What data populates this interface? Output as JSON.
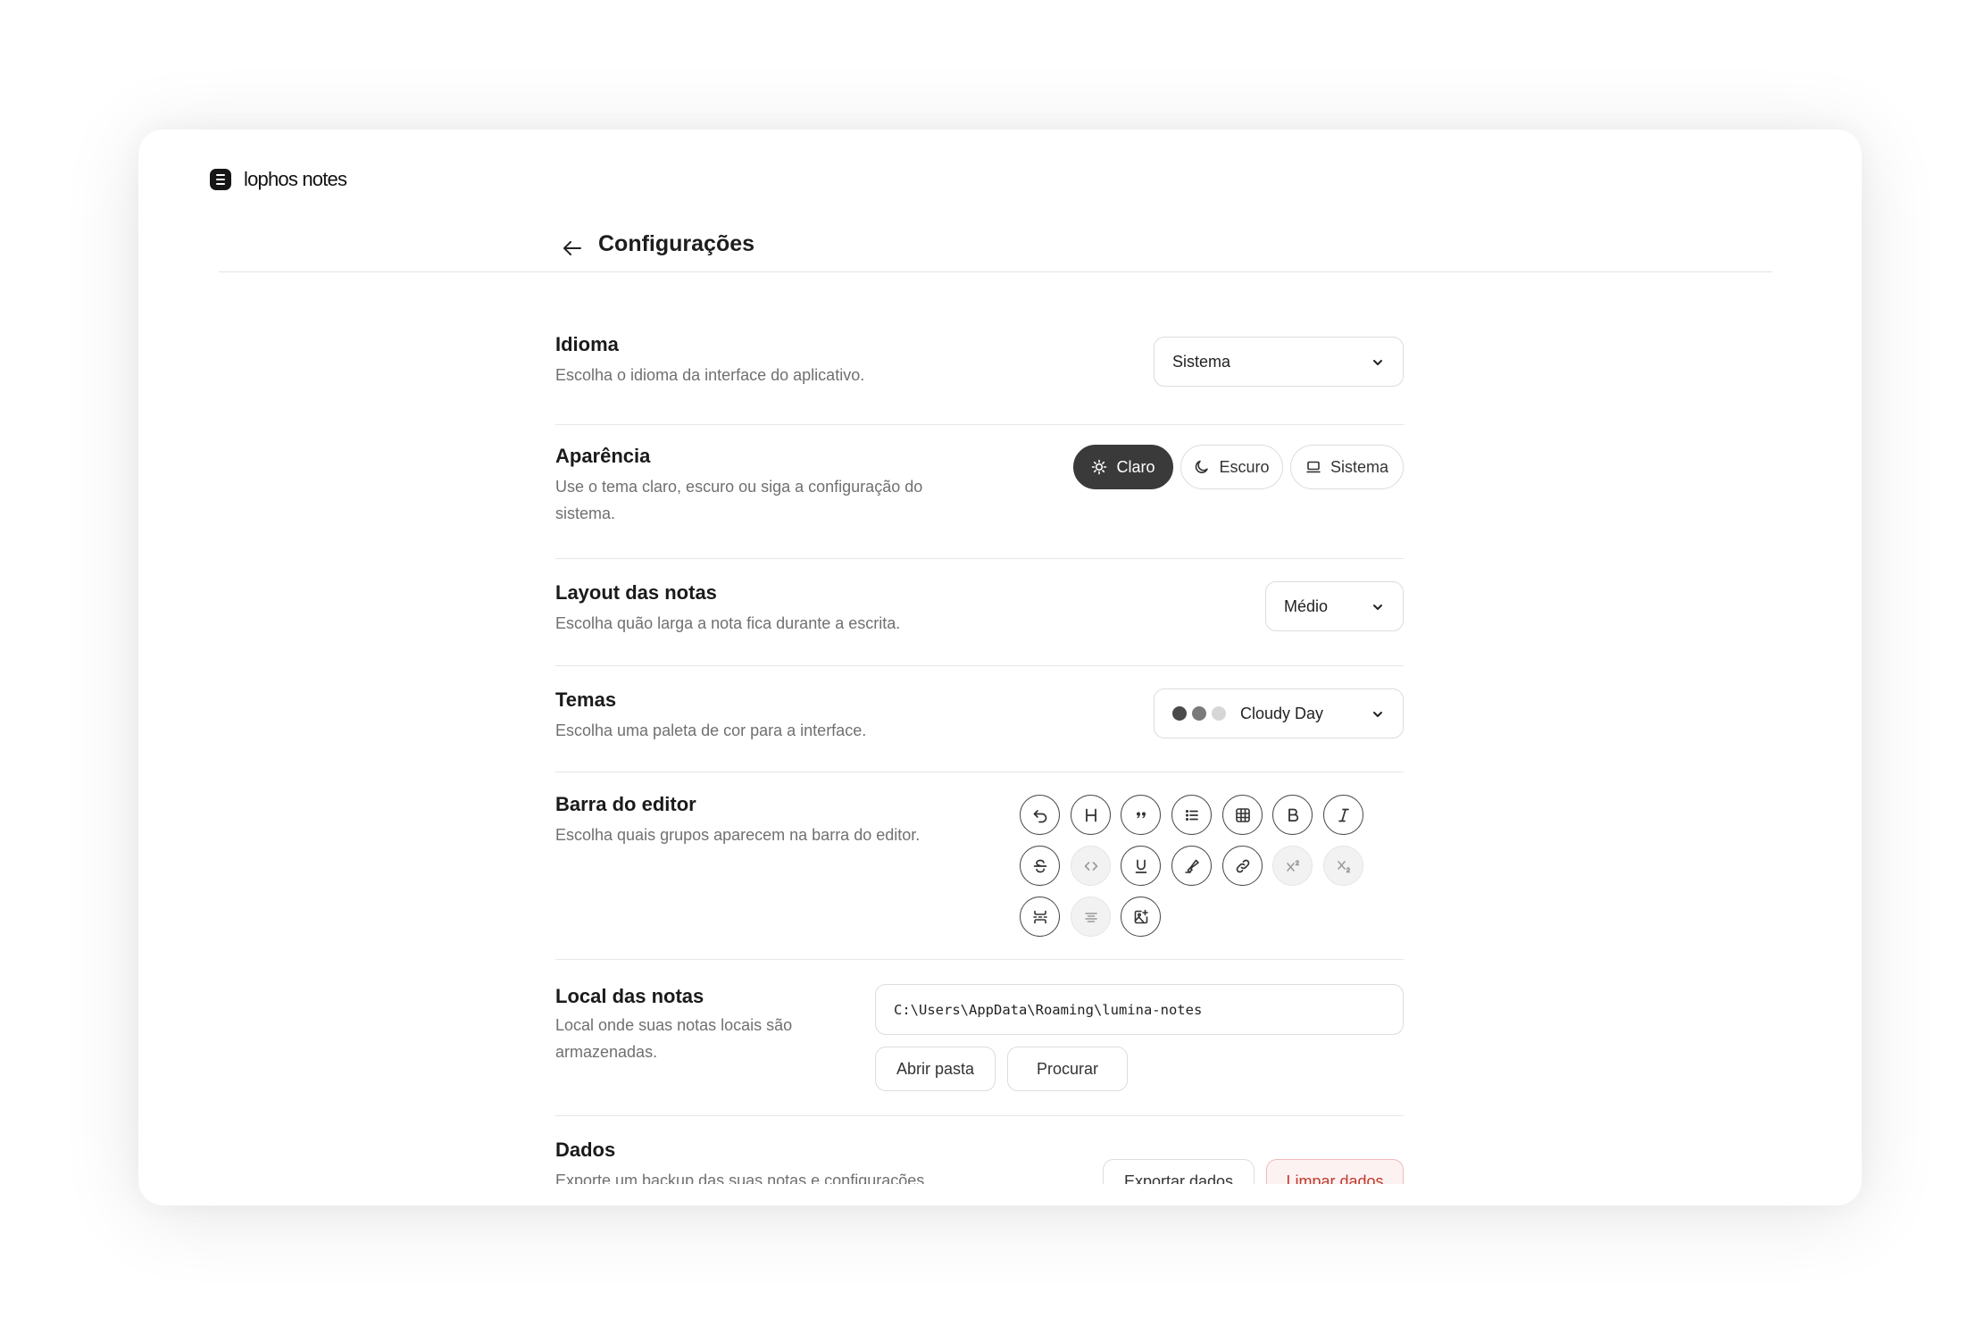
{
  "app": {
    "name": "lophos notes"
  },
  "header": {
    "title": "Configurações",
    "back_icon": "arrow-left-icon"
  },
  "settings": {
    "language": {
      "title": "Idioma",
      "description": "Escolha o idioma da interface do aplicativo.",
      "value": "Sistema"
    },
    "appearance": {
      "title": "Aparência",
      "description_line1": "Use o tema claro, escuro ou siga a configuração do",
      "description_line2": "sistema.",
      "options": [
        {
          "label": "Claro",
          "icon": "sun-icon",
          "selected": true
        },
        {
          "label": "Escuro",
          "icon": "moon-icon",
          "selected": false
        },
        {
          "label": "Sistema",
          "icon": "laptop-icon",
          "selected": false
        }
      ]
    },
    "layout": {
      "title": "Layout das notas",
      "description": "Escolha quão larga a nota fica durante a escrita.",
      "value": "Médio"
    },
    "themes": {
      "title": "Temas",
      "description": "Escolha uma paleta de cor para a interface.",
      "value": "Cloudy Day",
      "swatches": [
        "#4a4a4a",
        "#7a7a7a",
        "#d6d6d6"
      ]
    },
    "editor_bar": {
      "title": "Barra do editor",
      "description": "Escolha quais grupos aparecem na barra do editor.",
      "tools": [
        {
          "icon": "undo-icon",
          "enabled": true
        },
        {
          "icon": "heading-icon",
          "enabled": true
        },
        {
          "icon": "quote-icon",
          "enabled": true
        },
        {
          "icon": "list-icon",
          "enabled": true
        },
        {
          "icon": "table-icon",
          "enabled": true
        },
        {
          "icon": "bold-icon",
          "enabled": true
        },
        {
          "icon": "italic-icon",
          "enabled": true
        },
        {
          "icon": "strikethrough-icon",
          "enabled": true
        },
        {
          "icon": "code-icon",
          "enabled": false
        },
        {
          "icon": "underline-icon",
          "enabled": true
        },
        {
          "icon": "highlighter-icon",
          "enabled": true
        },
        {
          "icon": "link-icon",
          "enabled": true
        },
        {
          "icon": "superscript-icon",
          "enabled": false
        },
        {
          "icon": "subscript-icon",
          "enabled": false
        },
        {
          "icon": "page-break-icon",
          "enabled": true
        },
        {
          "icon": "align-center-icon",
          "enabled": false
        },
        {
          "icon": "image-icon",
          "enabled": true
        }
      ]
    },
    "notes_location": {
      "title": "Local das notas",
      "description_line1": "Local onde suas notas locais são",
      "description_line2": "armazenadas.",
      "path": "C:\\Users\\AppData\\Roaming\\lumina-notes",
      "open_folder_label": "Abrir pasta",
      "browse_label": "Procurar"
    },
    "data": {
      "title": "Dados",
      "description": "Exporte um backup das suas notas e configurações.",
      "export_label": "Exportar dados",
      "clear_label": "Limpar dados"
    }
  },
  "colors": {
    "accent": "#3a3a3a",
    "danger": "#c0392b",
    "danger_bg": "#fdf2f2"
  }
}
